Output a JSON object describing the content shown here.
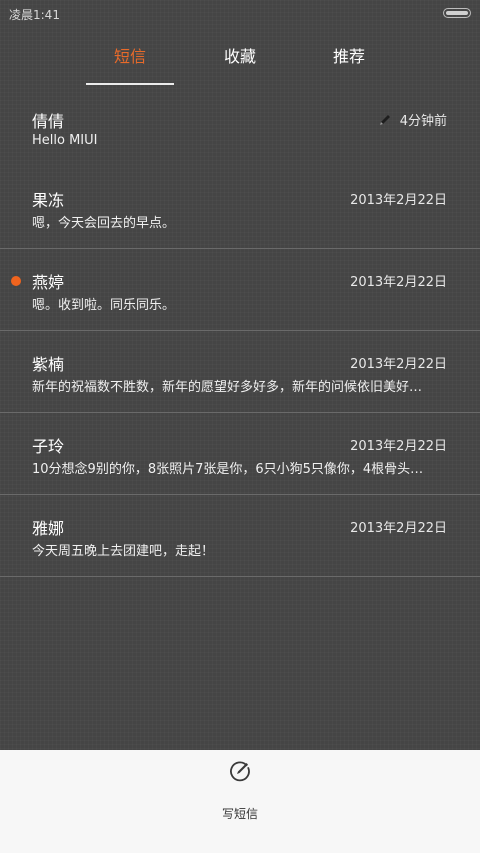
{
  "status_bar": {
    "time": "凌晨1:41"
  },
  "tabs": [
    {
      "label": "短信",
      "active": true
    },
    {
      "label": "收藏",
      "active": false
    },
    {
      "label": "推荐",
      "active": false
    }
  ],
  "accent_color": "#e86a2a",
  "unread_color": "#f0641e",
  "conversations": [
    {
      "name": "倩倩",
      "preview": "Hello MIUI",
      "time": "4分钟前",
      "draft": true
    },
    {
      "name": "果冻",
      "preview": "嗯，今天会回去的早点。",
      "time": "2013年2月22日"
    },
    {
      "name": "燕婷",
      "preview": "嗯。收到啦。同乐同乐。",
      "time": "2013年2月22日",
      "unread": true
    },
    {
      "name": "紫楠",
      "preview": "新年的祝福数不胜数，新年的愿望好多好多，新年的问候依旧美好…",
      "time": "2013年2月22日"
    },
    {
      "name": "子玲",
      "preview": "10分想念9别的你，8张照片7张是你，6只小狗5只像你，4根骨头…",
      "time": "2013年2月22日"
    },
    {
      "name": "雅娜",
      "preview": "今天周五晚上去团建吧，走起！",
      "time": "2013年2月22日"
    }
  ],
  "bottom_bar": {
    "compose_label": "写短信",
    "compose_icon": "compose-icon"
  }
}
